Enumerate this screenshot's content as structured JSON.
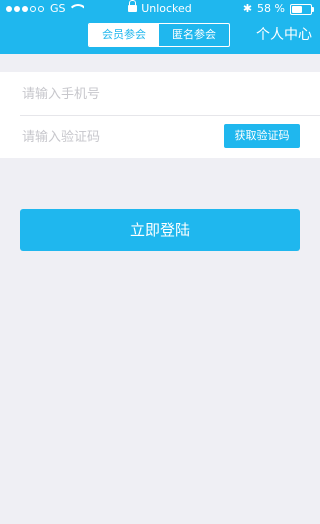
{
  "status_bar": {
    "carrier": "GS",
    "lock_label": "Unlocked",
    "battery_percent": "58 %",
    "battery_level": 0.58
  },
  "header": {
    "tabs": [
      {
        "label": "会员参会",
        "active": true
      },
      {
        "label": "匿名参会",
        "active": false
      }
    ],
    "personal_center": "个人中心"
  },
  "form": {
    "phone_placeholder": "请输入手机号",
    "code_placeholder": "请输入验证码",
    "get_code_button": "获取验证码"
  },
  "login_button": "立即登陆",
  "colors": {
    "accent": "#1fb7ee",
    "background": "#efeff4"
  }
}
